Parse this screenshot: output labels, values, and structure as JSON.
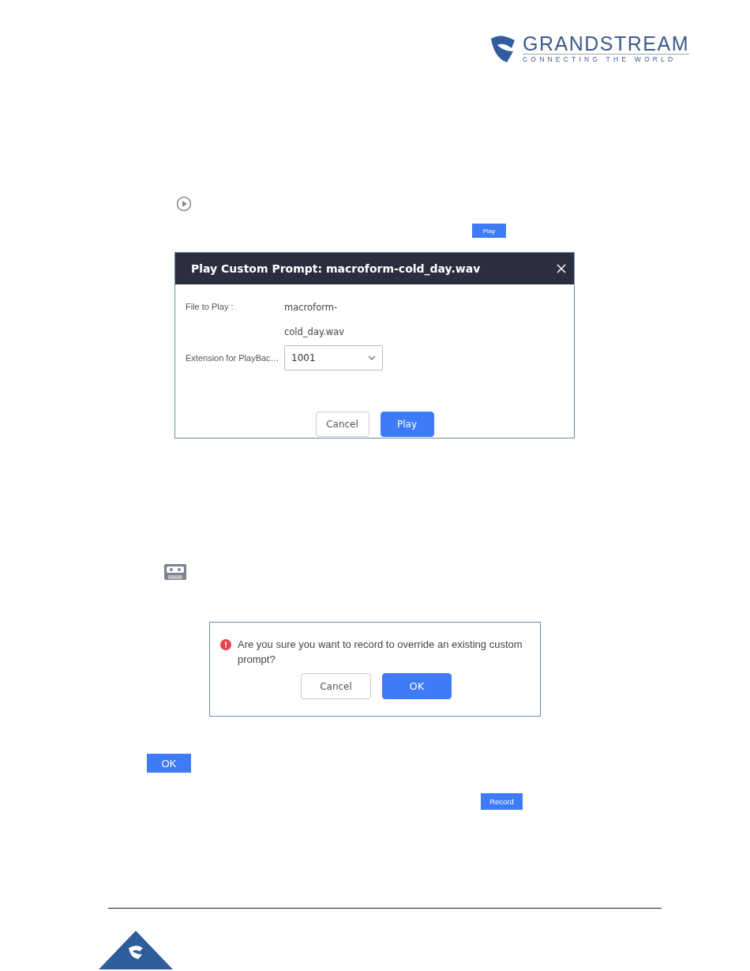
{
  "header_logo": {
    "name": "GRANDSTREAM",
    "tagline": "CONNECTING THE WORLD"
  },
  "inline_play_button": {
    "label": "Play"
  },
  "play_dialog": {
    "title": "Play Custom Prompt: macroform-cold_day.wav",
    "file": {
      "label": "File to Play :",
      "value_lines": [
        "macroform-",
        "cold_day.wav"
      ]
    },
    "extension": {
      "label": "Extension for PlayBac…",
      "value": "1001"
    },
    "buttons": [
      {
        "label": "Cancel",
        "kind": "secondary"
      },
      {
        "label": "Play",
        "kind": "primary"
      }
    ]
  },
  "confirm_dialog": {
    "message": "Are you sure you want to record to override an existing custom prompt?",
    "buttons": [
      {
        "label": "Cancel",
        "kind": "secondary"
      },
      {
        "label": "OK",
        "kind": "primary"
      }
    ]
  },
  "inline_ok_button": {
    "label": "OK"
  },
  "inline_record_button": {
    "label": "Record"
  }
}
